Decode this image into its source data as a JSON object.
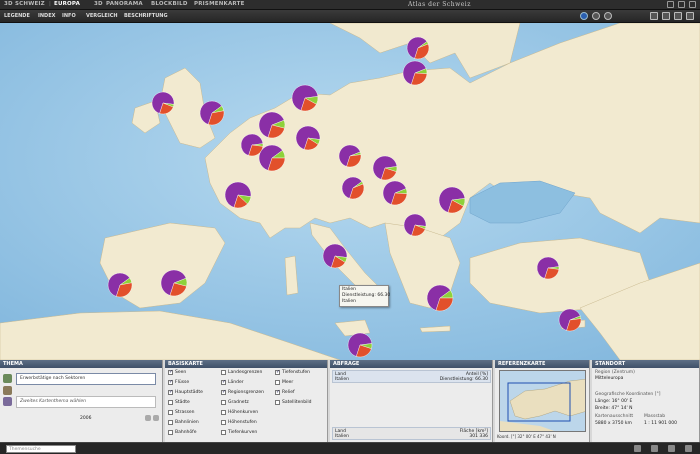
{
  "top_tabs": [
    "3D",
    "SCHWEIZ",
    "EUROPA",
    "3D",
    "PANORAMA",
    "BLOCKBILD",
    "PRISMENKARTE"
  ],
  "app_title": "Atlas der Schweiz",
  "menu": [
    "LEGENDE",
    "INDEX",
    "INFO",
    "VERGLEICH",
    "BESCHRIFTUNG"
  ],
  "popup": {
    "line1": "Italien",
    "line2": "Dienstleistung: 66.30",
    "line3": "Italien"
  },
  "panels": {
    "thema": {
      "title": "THEMA",
      "primary": "Erwerbstätige nach Sektoren",
      "secondary": "Zweites Kartenthema wählen",
      "year": "2006"
    },
    "basiskarte": {
      "title": "BASISKARTE",
      "col1": [
        {
          "label": "Seen",
          "checked": true
        },
        {
          "label": "Flüsse",
          "checked": true
        },
        {
          "label": "Hauptstädte",
          "checked": true
        },
        {
          "label": "Städte",
          "checked": false
        },
        {
          "label": "Strassen",
          "checked": false
        },
        {
          "label": "Bahnlinien",
          "checked": false
        },
        {
          "label": "Bahnhöfe",
          "checked": false
        }
      ],
      "col2": [
        {
          "label": "Landesgrenzen",
          "checked": false
        },
        {
          "label": "Länder",
          "checked": true
        },
        {
          "label": "Regionsgrenzen",
          "checked": true
        },
        {
          "label": "Gradnetz",
          "checked": false
        },
        {
          "label": "Höhenkurven",
          "checked": false
        },
        {
          "label": "Höhenstufen",
          "checked": false
        },
        {
          "label": "Tiefenkurven",
          "checked": false
        }
      ],
      "col3": [
        {
          "label": "Tiefenstufen",
          "checked": true
        },
        {
          "label": "Meer",
          "checked": false
        },
        {
          "label": "Relief",
          "checked": true
        },
        {
          "label": "Satellitenbild",
          "checked": false
        }
      ]
    },
    "abfrage": {
      "title": "ABFRAGE",
      "row1": {
        "col_left": "Land",
        "col_right": "Anteil [%]",
        "val_left": "Italien",
        "val_right": "Dienstleistung: 66.30"
      },
      "row2": {
        "col_left": "Land",
        "col_right": "Fläche [km²]",
        "val_left": "Italien",
        "val_right": "301 336"
      }
    },
    "referenzkarte": {
      "title": "REFERENZKARTE",
      "coords": "Koord. [°]  32° 00' E  47° 43' N"
    },
    "standort": {
      "title": "STANDORT",
      "region_label": "Region (Zentrum)",
      "region_value": "Mitteleuropa",
      "geo_label": "Geografische Koordinaten [°]",
      "laenge": "Länge: 16° 00' E",
      "breite": "Breite: 47° 14' N",
      "ausschnitt_label": "Kartenausschnitt",
      "ausschnitt_value": "5880 x 3750 km",
      "massstab_label": "Massstab",
      "massstab_value": "1 : 11 901 000"
    }
  },
  "statusbar": {
    "search_placeholder": "Themensuche"
  },
  "colors": {
    "agriculture": "#8ed13a",
    "industry": "#e2502b",
    "services": "#8a2fa6",
    "sea": "#9ec9e6",
    "land": "#f2ead0"
  },
  "pie_share_example": {
    "country": "Italien",
    "services_pct": 66.3
  }
}
